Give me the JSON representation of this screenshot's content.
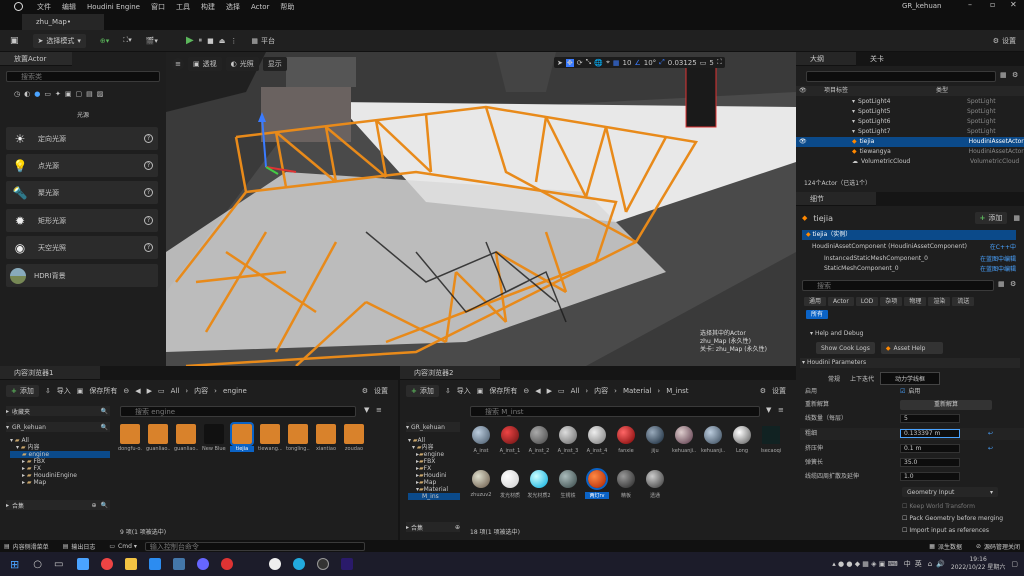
{
  "menu": {
    "items": [
      "文件",
      "编辑",
      "Houdini Engine",
      "窗口",
      "工具",
      "构建",
      "选择",
      "Actor",
      "帮助"
    ]
  },
  "project_name": "GR_kehuan",
  "map_tab": "zhu_Map•",
  "toolbar": {
    "mode_label": "选择模式",
    "platform_label": "平台",
    "settings_label": "设置"
  },
  "place_actors": {
    "tab_title": "放置Actor",
    "search_placeholder": "搜索类",
    "category": "光源",
    "items": [
      {
        "label": "定向光源",
        "icon": "sun-icon"
      },
      {
        "label": "点光源",
        "icon": "bulb-icon"
      },
      {
        "label": "聚光源",
        "icon": "spotlight-icon"
      },
      {
        "label": "矩形光源",
        "icon": "rect-light-icon"
      },
      {
        "label": "天空光照",
        "icon": "sky-light-icon"
      },
      {
        "label": "HDRI背景",
        "icon": "hdri-icon"
      }
    ]
  },
  "viewport": {
    "btn_perspective": "透视",
    "btn_lit": "光照",
    "btn_show": "显示",
    "grid_snap": "10",
    "angle_snap": "10°",
    "scale_snap": "0.03125",
    "camera_speed": "5",
    "layer_num": "1",
    "info_line1": "选择其中的Actor",
    "info_line2": "zhu_Map (永久性)",
    "info_line3": "关卡: zhu_Map (永久性)"
  },
  "outliner": {
    "tab_title": "大纲",
    "tab2": "关卡",
    "col_label": "项目标签",
    "col_type": "类型",
    "rows": [
      {
        "name": "SpotLight4",
        "type": "SpotLight"
      },
      {
        "name": "SpotLight5",
        "type": "SpotLight"
      },
      {
        "name": "SpotLight6",
        "type": "SpotLight"
      },
      {
        "name": "SpotLight7",
        "type": "SpotLight"
      },
      {
        "name": "tiejia",
        "type": "HoudiniAssetActor"
      },
      {
        "name": "tiewangya",
        "type": "HoudiniAssetActor"
      },
      {
        "name": "VolumetricCloud",
        "type": "VolumetricCloud"
      }
    ],
    "count": "124个Actor（已选1个）"
  },
  "details": {
    "tab_title": "细节",
    "actor_name": "tiejia",
    "add_label": "添加",
    "instance_label": "tiejia（实例）",
    "components": [
      {
        "name": "HoudiniAssetComponent (HoudiniAssetComponent)",
        "link": "在C++中"
      },
      {
        "name": "InstancedStaticMeshComponent_0",
        "link": "在蓝图中编辑"
      },
      {
        "name": "StaticMeshComponent_0",
        "link": "在蓝图中编辑"
      }
    ],
    "search_placeholder": "搜索",
    "filters": [
      "通用",
      "Actor",
      "LOD",
      "杂项",
      "物理",
      "渲染",
      "流送"
    ],
    "filter_all": "所有",
    "help_section": "Help and Debug",
    "cook_logs": "Show Cook Logs",
    "asset_help": "Asset Help",
    "params_section": "Houdini Parameters",
    "subtabs": [
      "常规",
      "上下迭代",
      "动力学线框"
    ],
    "props": [
      {
        "label": "启用",
        "value": "启用"
      },
      {
        "label": "重新解算",
        "value": "重新解算"
      },
      {
        "label": "线数量（每层）",
        "value": "5"
      },
      {
        "label": "粗细",
        "value": "0.133397 m"
      },
      {
        "label": "挤压伸",
        "value": "0.1 m"
      },
      {
        "label": "弹簧长",
        "value": "35.0"
      },
      {
        "label": "线缆四周扩散及延伸",
        "value": "1.0"
      }
    ],
    "geom_input": "Geometry Input",
    "checks": [
      "Keep World Transform",
      "Pack Geometry before merging",
      "Import input as references"
    ]
  },
  "cb1": {
    "tab_title": "内容浏览器1",
    "add": "添加",
    "import": "导入",
    "save_all": "保存所有",
    "settings": "设置",
    "path": [
      "All",
      "内容",
      "engine"
    ],
    "favorites": "收藏夹",
    "project": "GR_kehuan",
    "tree": [
      "All",
      "内容",
      "engine",
      "FBX",
      "FX",
      "HoudiniEngine",
      "Map"
    ],
    "collections": "合集",
    "search_placeholder": "搜索 engine",
    "assets": [
      "dongfu-o...",
      "guanliao...",
      "guanliao...",
      "New Blueprint",
      "tiejia",
      "tiewang...",
      "tongling...",
      "xiantiao",
      "zoudao"
    ],
    "status": "9 项(1 项被选中)"
  },
  "cb2": {
    "tab_title": "内容浏览器2",
    "add": "添加",
    "import": "导入",
    "save_all": "保存所有",
    "settings": "设置",
    "path": [
      "All",
      "内容",
      "Material",
      "M_inst"
    ],
    "project": "GR_kehuan",
    "tree": [
      "All",
      "内容",
      "engine",
      "FBX",
      "FX",
      "Houdini",
      "Map",
      "Material",
      "M_ins"
    ],
    "collections": "合集",
    "search_placeholder": "搜索 M_inst",
    "materials": [
      "A_inst",
      "A_inst_1",
      "A_inst_2",
      "A_inst_3",
      "A_inst_4",
      "fanxie",
      "jiju",
      "kehuanji...",
      "kehuanji...2",
      "Long",
      "lsecaoqi",
      "zhuzuv2",
      "发光材质",
      "发光材质2",
      "生锈铁",
      "两灯rv",
      "精板",
      "透通"
    ],
    "status": "18 项(1 项被选中)"
  },
  "bottom_bar": {
    "content_drawer": "内容侧滑菜单",
    "output_log": "输出日志",
    "cmd": "Cmd",
    "cmd_placeholder": "输入控制台命令",
    "derived_data": "派生数据",
    "source_control": "源码管理关闭"
  },
  "taskbar": {
    "lang1": "中",
    "lang2": "英",
    "time": "19:16",
    "date": "2022/10/22 星期六"
  }
}
